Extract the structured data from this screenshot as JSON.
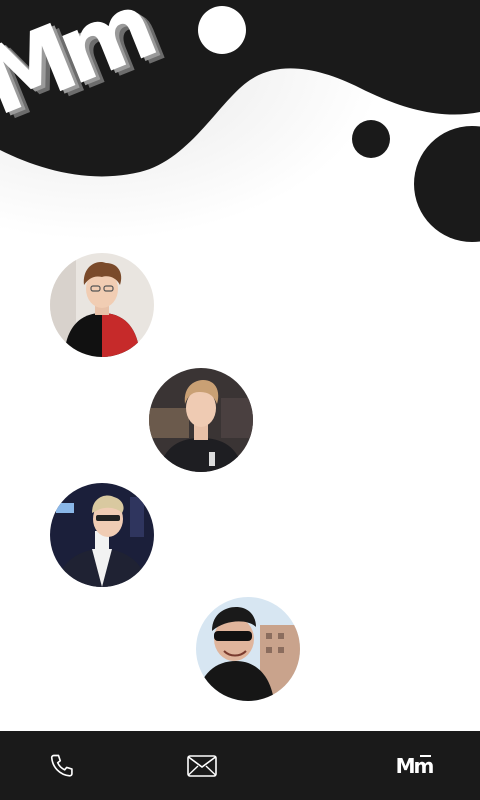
{
  "brand": {
    "logo_text": "Mm",
    "nav_logo_text": "Mm"
  },
  "team": {
    "members": [
      {
        "icon": "avatar-photo",
        "shirt_color": "#c62a2a"
      },
      {
        "icon": "avatar-photo",
        "shirt_color": "#1e1e22"
      },
      {
        "icon": "avatar-photo",
        "shirt_color": "#1f2233"
      },
      {
        "icon": "avatar-photo",
        "shirt_color": "#161616"
      }
    ]
  },
  "bottom_nav": {
    "items": [
      {
        "icon": "phone-icon"
      },
      {
        "icon": "mail-icon"
      },
      {
        "icon": "brand-logo-icon"
      }
    ]
  },
  "colors": {
    "dark": "#1a1a1a",
    "background": "#ffffff"
  }
}
